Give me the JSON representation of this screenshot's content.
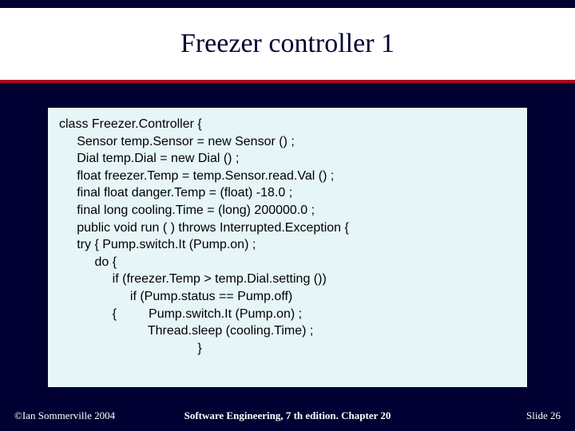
{
  "title": "Freezer controller 1",
  "code": {
    "lines": [
      "class Freezer.Controller {",
      "     Sensor temp.Sensor = new Sensor () ;",
      "     Dial temp.Dial = new Dial () ;",
      "     float freezer.Temp = temp.Sensor.read.Val () ;",
      "     final float danger.Temp = (float) -18.0 ;",
      "     final long cooling.Time = (long) 200000.0 ;",
      "     public void run ( ) throws Interrupted.Exception {",
      "     try { Pump.switch.It (Pump.on) ;",
      "          do {",
      "               if (freezer.Temp > temp.Dial.setting ())",
      "                    if (Pump.status == Pump.off)",
      "               {         Pump.switch.It (Pump.on) ;",
      "                         Thread.sleep (cooling.Time) ;",
      "                                       }"
    ]
  },
  "footer": {
    "copyright": "©Ian Sommerville 2004",
    "center": "Software Engineering, 7 th edition. Chapter 20",
    "slide": "Slide  26"
  }
}
